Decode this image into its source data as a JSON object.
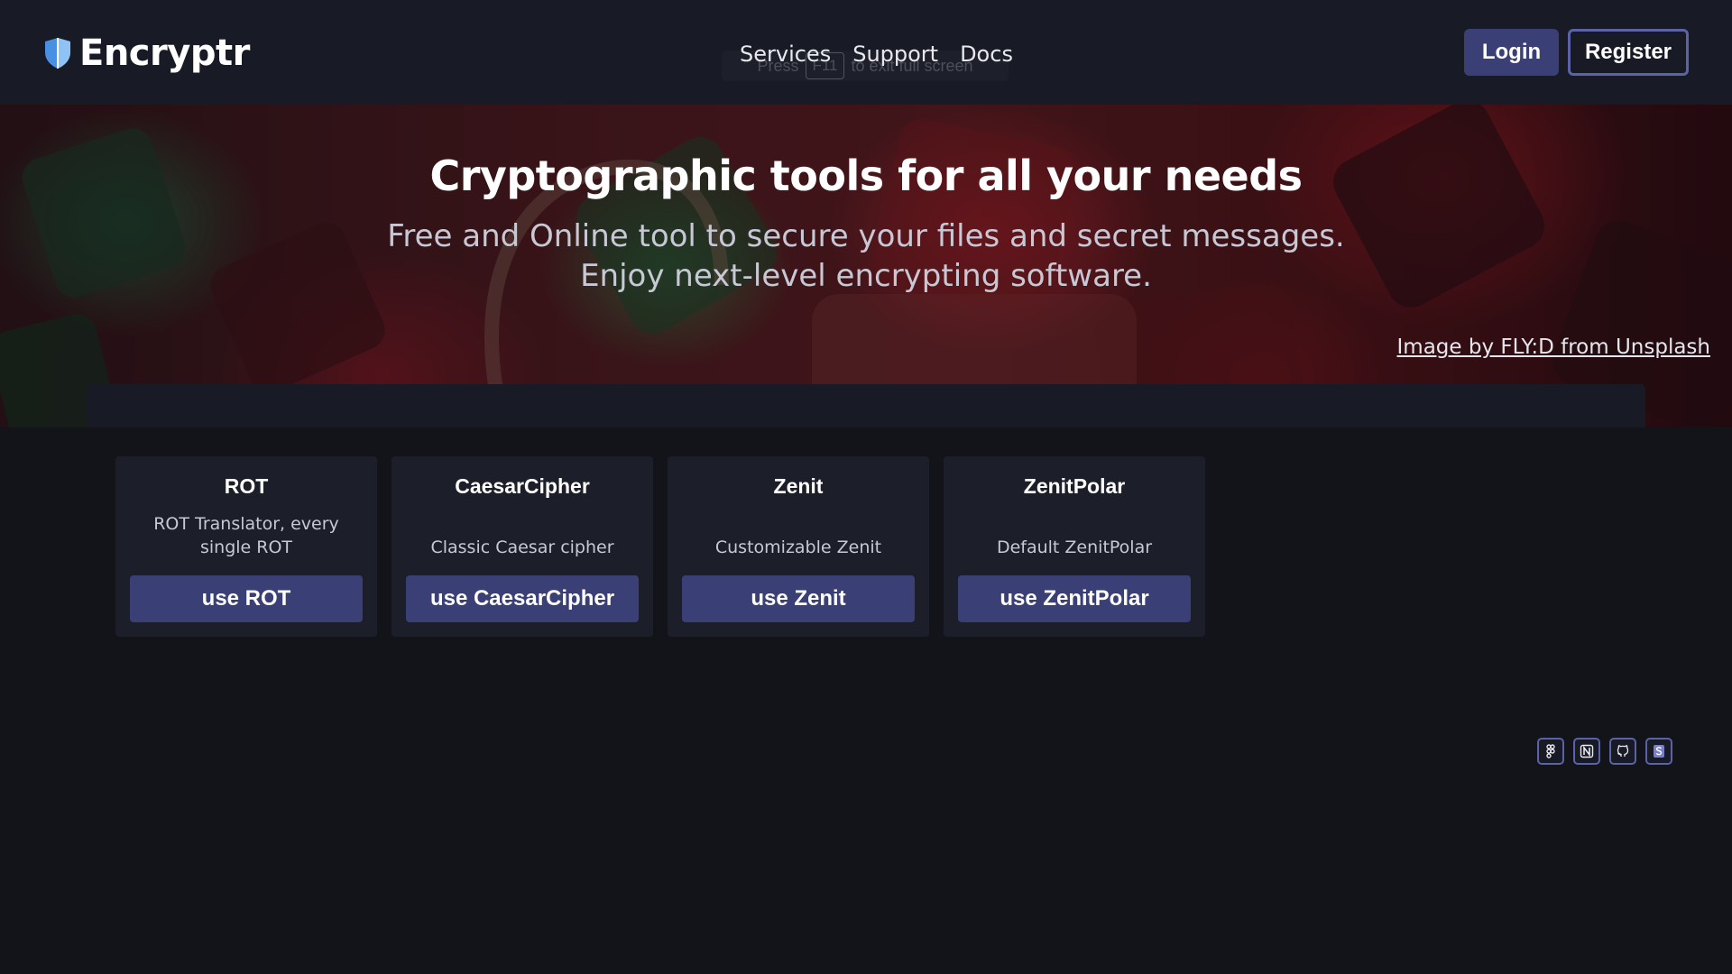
{
  "header": {
    "brand": "Encryptr",
    "nav": [
      "Services",
      "Support",
      "Docs"
    ],
    "login_label": "Login",
    "register_label": "Register",
    "fullscreen_hint": {
      "before": "Press",
      "key": "F11",
      "after": "to exit full screen"
    }
  },
  "hero": {
    "title": "Cryptographic tools for all your needs",
    "subtitle": "Free and Online tool to secure your files and secret messages. Enjoy next-level encrypting software.",
    "credit": "Image by FLY:D from Unsplash"
  },
  "cards": [
    {
      "title": "ROT",
      "description": "ROT Translator, every single ROT",
      "button": "use ROT"
    },
    {
      "title": "CaesarCipher",
      "description": "Classic Caesar cipher",
      "button": "use CaesarCipher"
    },
    {
      "title": "Zenit",
      "description": "Customizable Zenit",
      "button": "use Zenit"
    },
    {
      "title": "ZenitPolar",
      "description": "Default ZenitPolar",
      "button": "use ZenitPolar"
    }
  ],
  "socials": [
    "figma-icon",
    "notion-icon",
    "github-icon",
    "skype-icon"
  ],
  "colors": {
    "accent": "#3a3f75",
    "accent_border": "#5c62a6",
    "background": "#13131a",
    "header": "#181b25",
    "card": "#1c1f2a"
  }
}
